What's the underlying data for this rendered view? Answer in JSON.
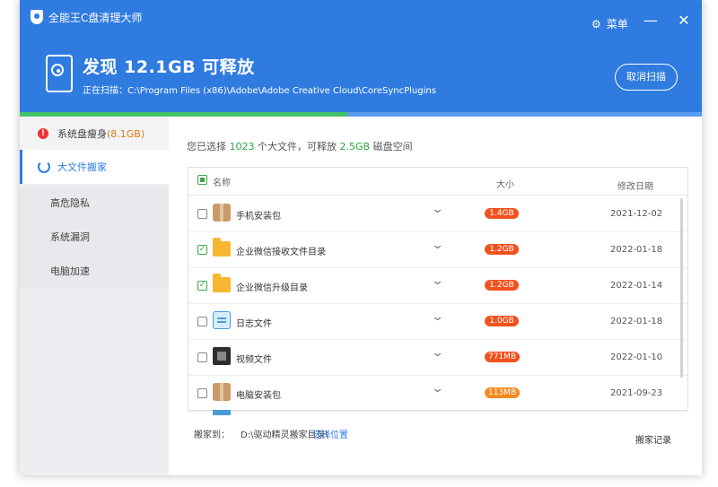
{
  "app": {
    "title": "全能王C盘清理大师"
  },
  "titlebar": {
    "menu_label": "菜单",
    "minimize": "—",
    "close": "✕"
  },
  "scan": {
    "headline": "发现 12.1GB 可释放",
    "scanning_prefix": "正在扫描：",
    "scanning_path": "C:\\Program Files (x86)\\Adobe\\Adobe Creative Cloud\\CoreSyncPlugins",
    "cancel_label": "取消扫描",
    "progress_percent": 48
  },
  "sidebar": {
    "top_item": {
      "label": "系统盘瘦身",
      "badge": "(8.1GB)"
    },
    "active_item": "大文件搬家",
    "sub_items": [
      "高危隐私",
      "系统漏洞",
      "电脑加速"
    ]
  },
  "summary": {
    "prefix": "您已选择",
    "count": "1023",
    "middle": "个大文件，可释放",
    "size": "2.5GB",
    "suffix": "磁盘空间"
  },
  "table": {
    "columns": {
      "name": "名称",
      "size": "大小",
      "date": "修改日期"
    },
    "rows": [
      {
        "name": "手机安装包",
        "size": "1.4GB",
        "date": "2021-12-02",
        "checked": false,
        "icon": "package-icon",
        "color": "#f0521f"
      },
      {
        "name": "企业微信接收文件目录",
        "size": "1.2GB",
        "date": "2022-01-18",
        "checked": true,
        "icon": "folder-icon",
        "color": "#f0521f"
      },
      {
        "name": "企业微信升级目录",
        "size": "1.2GB",
        "date": "2022-01-14",
        "checked": true,
        "icon": "folder-icon",
        "color": "#f0521f"
      },
      {
        "name": "日志文件",
        "size": "1.0GB",
        "date": "2022-01-18",
        "checked": false,
        "icon": "log-icon",
        "color": "#f0521f"
      },
      {
        "name": "视频文件",
        "size": "771MB",
        "date": "2022-01-10",
        "checked": false,
        "icon": "video-icon",
        "color": "#f0521f"
      },
      {
        "name": "电脑安装包",
        "size": "113MB",
        "date": "2021-09-23",
        "checked": false,
        "icon": "package-icon",
        "color": "#f58a1f"
      }
    ]
  },
  "footer": {
    "move_to_label": "搬家到：",
    "path": "D:\\驱动精灵搬家目录\\",
    "change_label": "选择位置",
    "records_label": "搬家记录"
  }
}
